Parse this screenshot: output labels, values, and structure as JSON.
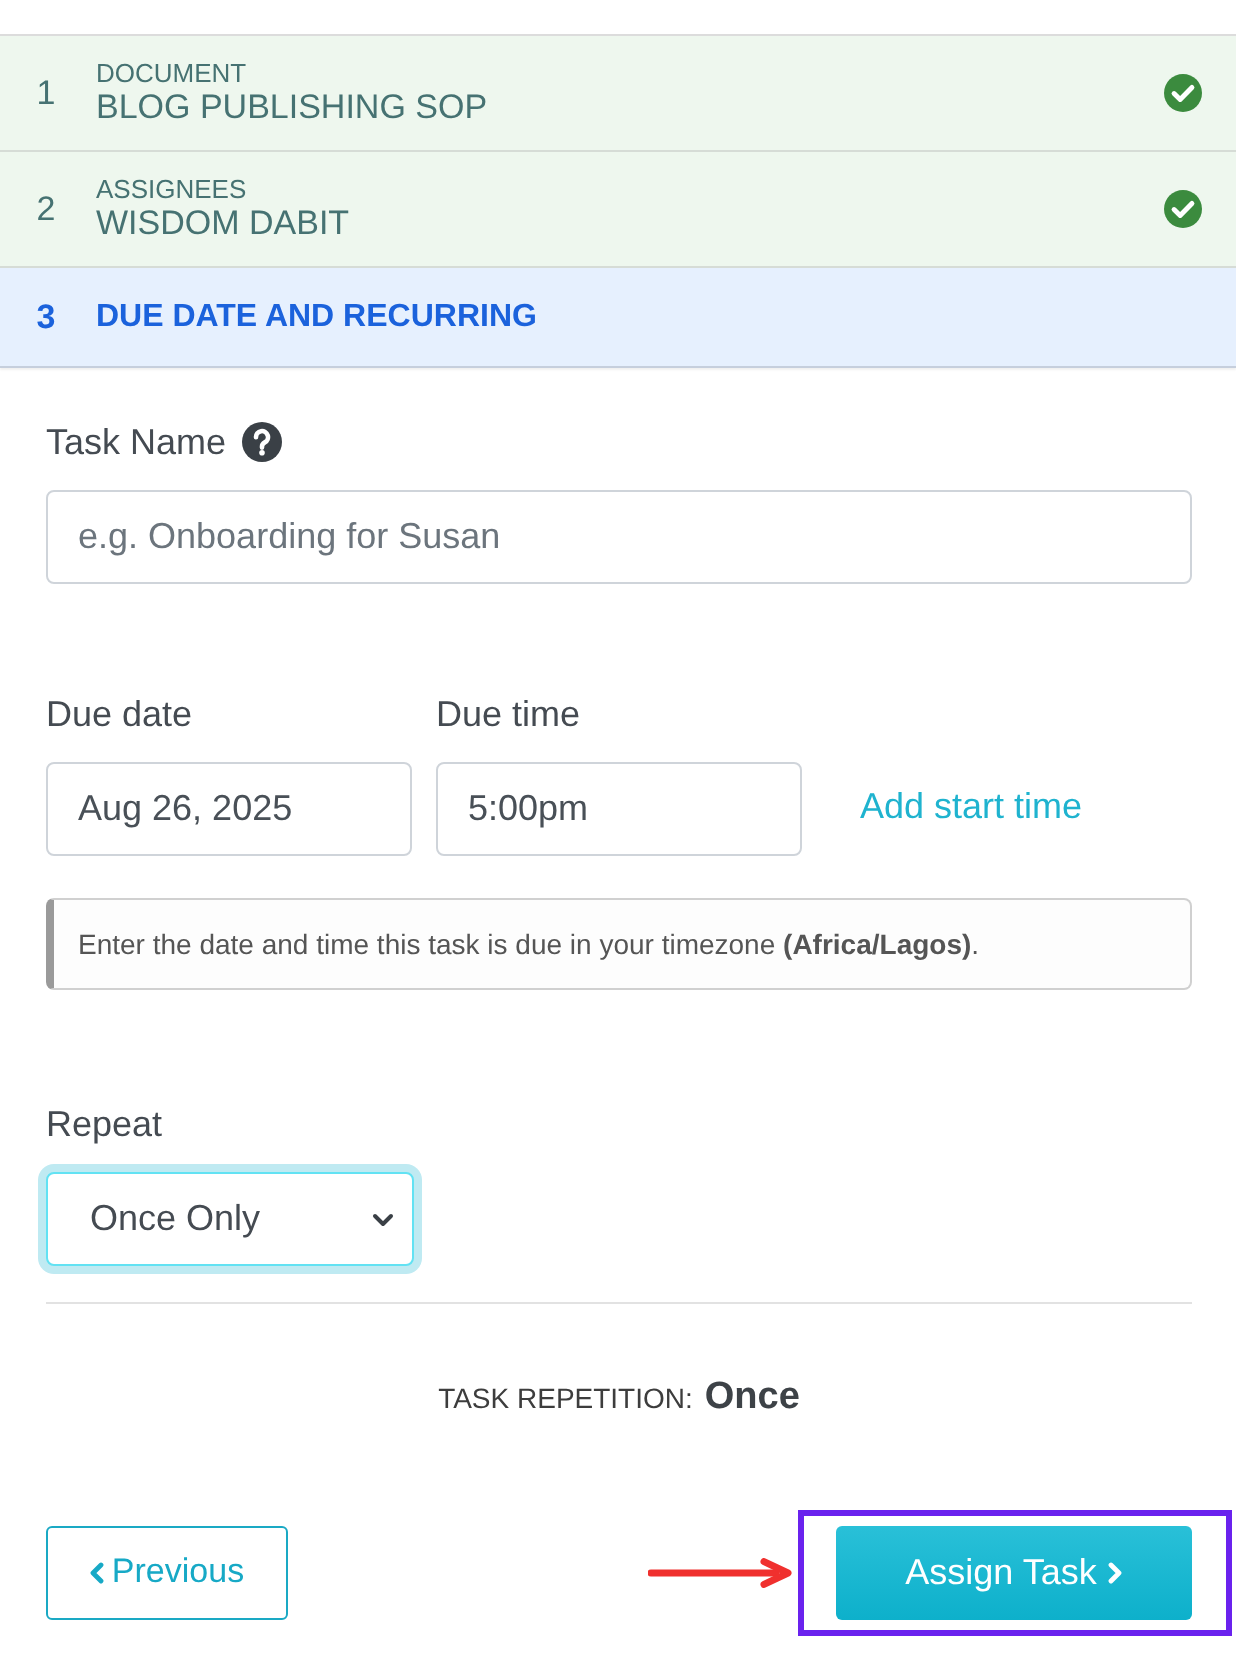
{
  "steps": [
    {
      "number": "1",
      "caption": "DOCUMENT",
      "title": "BLOG PUBLISHING SOP",
      "completed": true,
      "selected": false
    },
    {
      "number": "2",
      "caption": "ASSIGNEES",
      "title": "WISDOM DABIT",
      "completed": true,
      "selected": false
    },
    {
      "number": "3",
      "title": "DUE DATE AND RECURRING",
      "completed": false,
      "selected": true
    }
  ],
  "form": {
    "task_name": {
      "label": "Task Name",
      "placeholder": "e.g. Onboarding for Susan"
    },
    "due_date": {
      "label": "Due date",
      "value": "Aug 26, 2025"
    },
    "due_time": {
      "label": "Due time",
      "value": "5:00pm"
    },
    "add_start_time": "Add start time",
    "note": "Enter the date and time this task is due in your timezone **(Africa/Lagos)**.",
    "repeat": {
      "label": "Repeat",
      "value": "Once Only",
      "focused": true
    }
  },
  "summary": {
    "label": "TASK REPETITION:",
    "value": "Once"
  },
  "buttons": [
    {
      "kind": "previous",
      "label": "Previous",
      "highlighted": false
    },
    {
      "kind": "assign",
      "label": "Assign Task",
      "highlighted": true
    }
  ]
}
